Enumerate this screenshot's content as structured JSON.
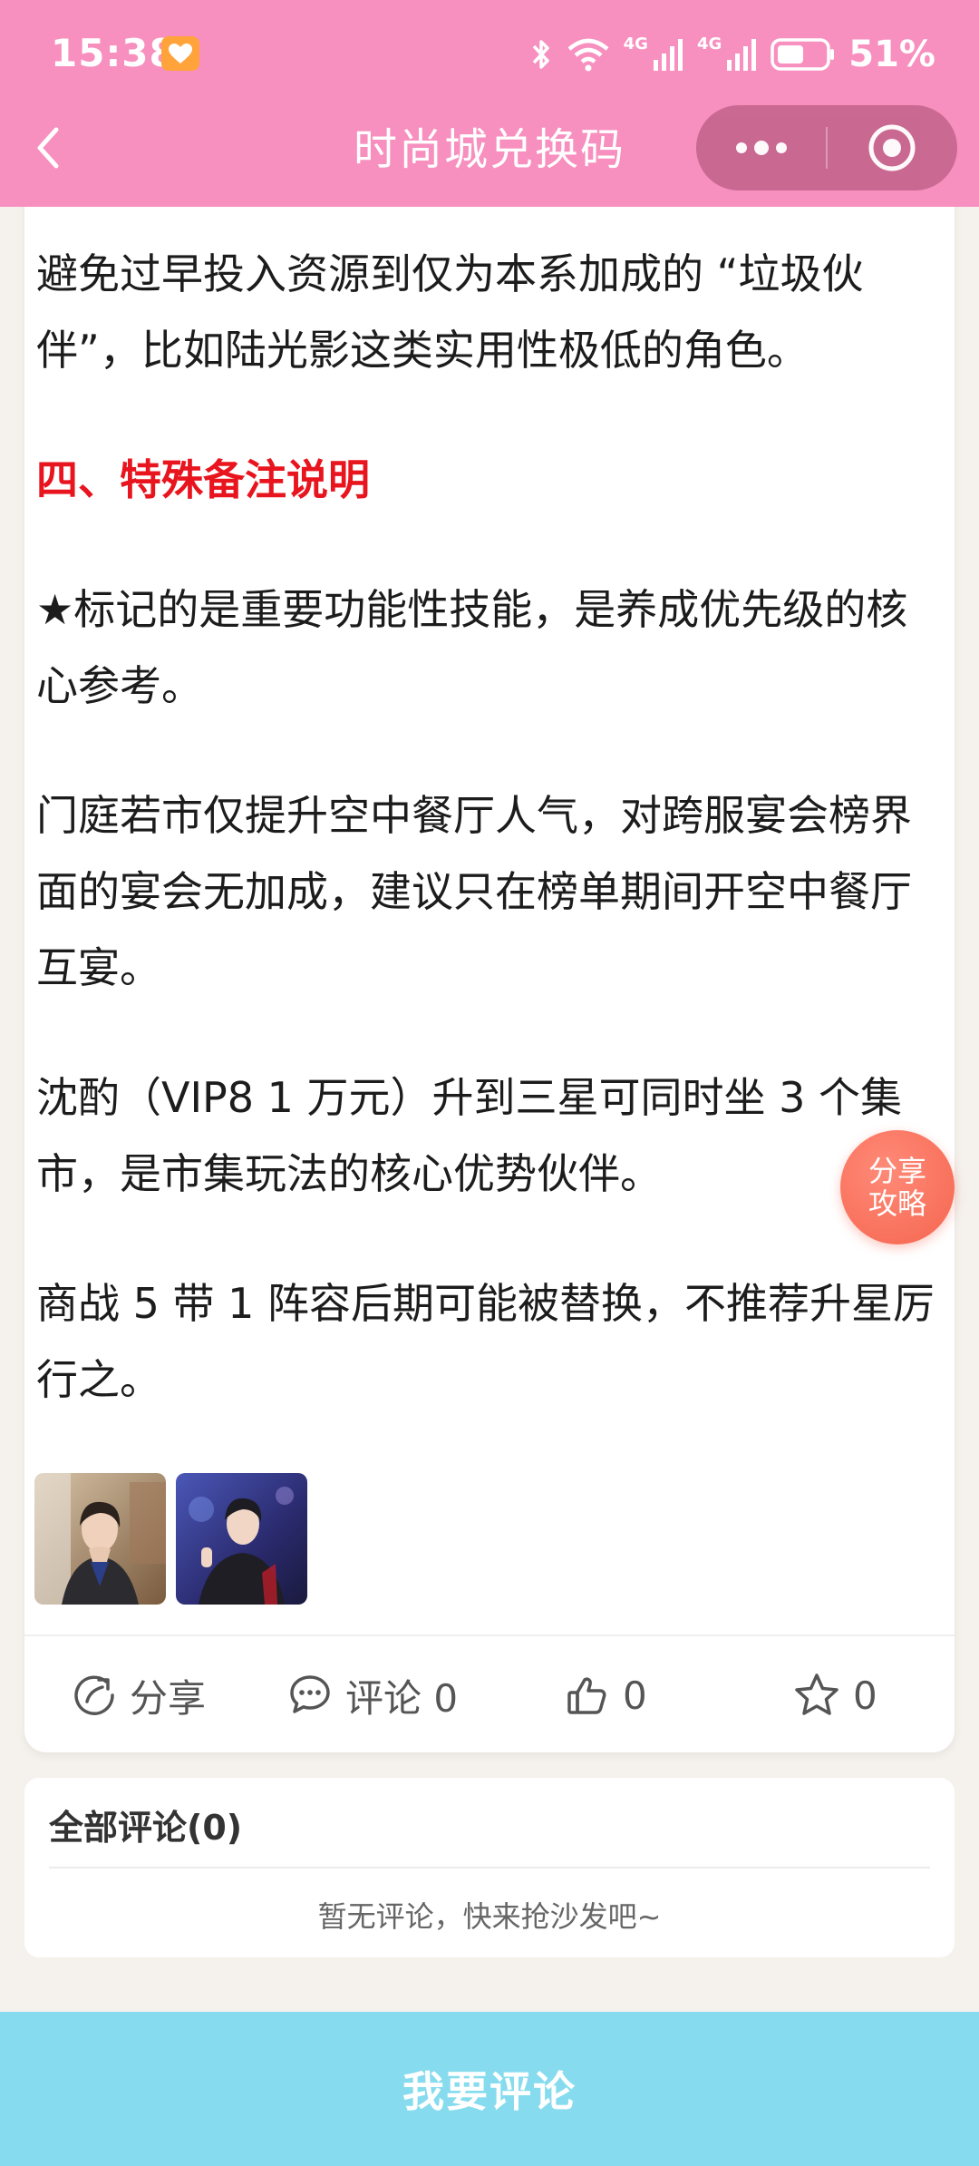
{
  "status_bar": {
    "time": "15:38",
    "network_1": "4G",
    "network_2": "4G",
    "battery": "51%"
  },
  "nav": {
    "title": "时尚城兑换码"
  },
  "article": {
    "paragraphs": [
      "避免过早投入资源到仅为本系加成的 “垃圾伙伴”，比如陆光影这类实用性极低的角色。",
      "四、特殊备注说明",
      "★标记的是重要功能性技能，是养成优先级的核心参考。",
      "门庭若市仅提升空中餐厅人气，对跨服宴会榜界面的宴会无加成，建议只在榜单期间开空中餐厅互宴。",
      "沈酌（VIP8 1 万元）升到三星可同时坐 3 个集市，是市集玩法的核心优势伙伴。",
      "商战 5 带 1 阵容后期可能被替换，不推荐升星厉行之。"
    ]
  },
  "actions": {
    "share_label": "分享",
    "comment_label": "评论 0",
    "like_count": "0",
    "favorite_count": "0"
  },
  "share_float": {
    "line1": "分享",
    "line2": "攻略"
  },
  "comments": {
    "title": "全部评论(0)",
    "empty_text": "暂无评论，快来抢沙发吧~"
  },
  "bottom_button": {
    "label": "我要评论"
  },
  "colors": {
    "header_bg": "#f78fbf",
    "heading_red": "#e8141e",
    "button_bg": "#86dcee",
    "share_float": "#f5664f"
  }
}
